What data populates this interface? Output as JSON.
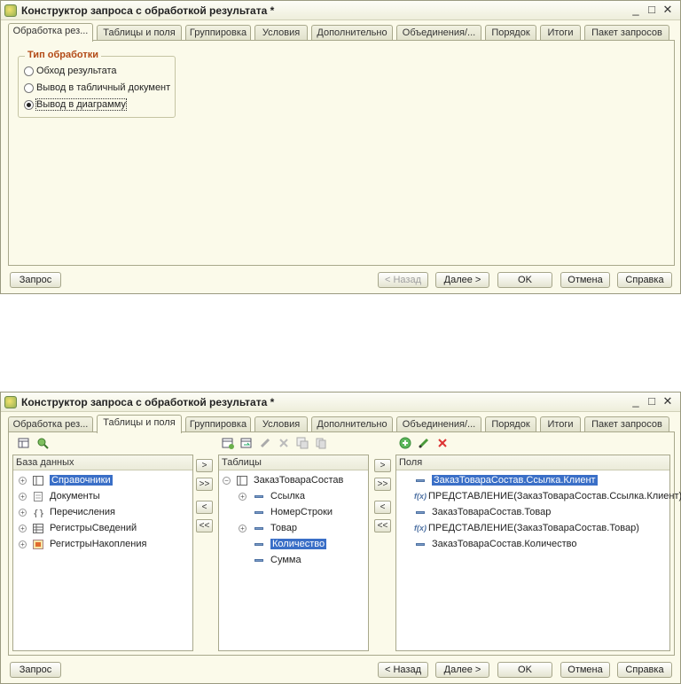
{
  "window_title": "Конструктор запроса с обработкой результата *",
  "window_controls": {
    "minimize": "_",
    "maximize": "□",
    "close": "✕"
  },
  "tabs": [
    "Обработка рез...",
    "Таблицы и поля",
    "Группировка",
    "Условия",
    "Дополнительно",
    "Объединения/...",
    "Порядок",
    "Итоги",
    "Пакет запросов"
  ],
  "screen1": {
    "active_tab": 0,
    "group_title": "Тип обработки",
    "options": [
      "Обход результата",
      "Вывод в табличный документ",
      "Вывод в диаграмму"
    ],
    "selected_option": 2
  },
  "screen2": {
    "active_tab": 1,
    "db_header": "База данных",
    "db_items": [
      "Справочники",
      "Документы",
      "Перечисления",
      "РегистрыСведений",
      "РегистрыНакопления"
    ],
    "tables_header": "Таблицы",
    "table_root": "ЗаказТовараСостав",
    "table_children": [
      "Ссылка",
      "НомерСтроки",
      "Товар",
      "Количество",
      "Сумма"
    ],
    "fields_header": "Поля",
    "fields": [
      "ЗаказТовараСостав.Ссылка.Клиент",
      "ПРЕДСТАВЛЕНИЕ(ЗаказТовараСостав.Ссылка.Клиент)",
      "ЗаказТовараСостав.Товар",
      "ПРЕДСТАВЛЕНИЕ(ЗаказТовараСостав.Товар)",
      "ЗаказТовараСостав.Количество"
    ],
    "func_label": "f(x)",
    "arrows": [
      ">",
      ">>",
      "<",
      "<<"
    ]
  },
  "buttons": {
    "query": "Запрос",
    "back": "< Назад",
    "next": "Далее >",
    "ok": "OK",
    "cancel": "Отмена",
    "help": "Справка"
  },
  "colors": {
    "accent": "#b34a17",
    "selection": "#3a6fc7",
    "window_bg": "#fbfaea"
  }
}
